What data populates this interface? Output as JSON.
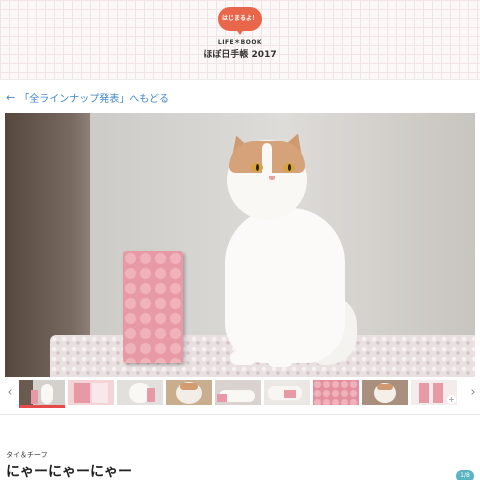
{
  "header": {
    "badge_text": "はじまるよ！",
    "brand_small": "LIFE＊BOOK",
    "brand_title": "ほぼ日手帳 2017"
  },
  "nav": {
    "back_link_label": "「全ラインナップ発表」へもどる",
    "back_arrow_icon": "arrow-left-icon"
  },
  "gallery": {
    "main_image": "cat-with-pink-notebook-photo",
    "prev_icon": "chevron-left-icon",
    "next_icon": "chevron-right-icon",
    "active_index": 0,
    "thumbnails": [
      {
        "subject": "cat-and-notebook"
      },
      {
        "subject": "pink-notebook-spread"
      },
      {
        "subject": "white-cat-closeup"
      },
      {
        "subject": "cat-face"
      },
      {
        "subject": "cat-lying-down"
      },
      {
        "subject": "cat-on-table"
      },
      {
        "subject": "notebook-pages"
      },
      {
        "subject": "cat-paws"
      },
      {
        "subject": "cat-portrait"
      },
      {
        "subject": "notebook-inside"
      }
    ]
  },
  "product": {
    "brand": "タイ＆チーフ",
    "title": "にゃーにゃーにゃー",
    "page_indicator": "1/8"
  },
  "colors": {
    "badge": "#e8664a",
    "link": "#3f86c9",
    "active_thumb": "#e54b4b",
    "page_badge": "#5ab4c4",
    "notebook": "#e79aa6"
  }
}
